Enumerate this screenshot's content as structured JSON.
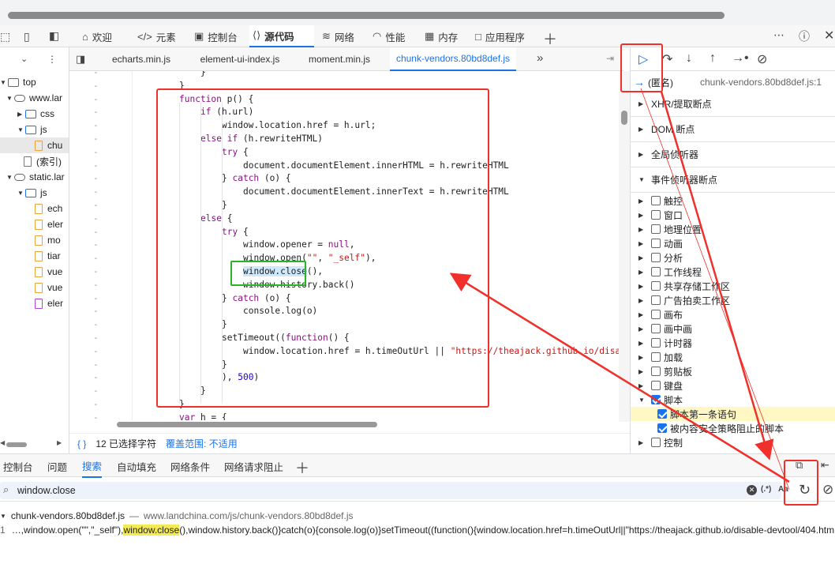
{
  "main_tabs": [
    {
      "label": "欢迎",
      "icon": "home-icon"
    },
    {
      "label": "元素",
      "icon": "code-brackets-icon"
    },
    {
      "label": "控制台",
      "icon": "console-icon"
    },
    {
      "label": "源代码",
      "icon": "sources-icon"
    },
    {
      "label": "网络",
      "icon": "wifi-icon"
    },
    {
      "label": "性能",
      "icon": "gauge-icon"
    },
    {
      "label": "内存",
      "icon": "chip-icon"
    },
    {
      "label": "应用程序",
      "icon": "app-icon"
    }
  ],
  "file_tree": [
    {
      "label": "top",
      "type": "frame"
    },
    {
      "label": "www.lar",
      "type": "cloud"
    },
    {
      "label": "css",
      "type": "folder"
    },
    {
      "label": "js",
      "type": "folder"
    },
    {
      "label": "chu",
      "type": "file"
    },
    {
      "label": "(索引)",
      "type": "file"
    },
    {
      "label": "static.lar",
      "type": "cloud"
    },
    {
      "label": "js",
      "type": "folder"
    },
    {
      "label": "ech",
      "type": "file"
    },
    {
      "label": "eler",
      "type": "file"
    },
    {
      "label": "mo",
      "type": "file"
    },
    {
      "label": "tiar",
      "type": "file"
    },
    {
      "label": "vue",
      "type": "file"
    },
    {
      "label": "vue",
      "type": "file"
    },
    {
      "label": "eler",
      "type": "file"
    }
  ],
  "editor_tabs": [
    "echarts.min.js",
    "element-ui-index.js",
    "moment.min.js",
    "chunk-vendors.80bd8def.js"
  ],
  "code_lines": [
    {
      "indent": 2,
      "text": "}"
    },
    {
      "indent": 1,
      "text": "}"
    },
    {
      "indent": 1,
      "text": "function p() {"
    },
    {
      "indent": 2,
      "text": "if (h.url)"
    },
    {
      "indent": 3,
      "text": "window.location.href = h.url;"
    },
    {
      "indent": 2,
      "text": "else if (h.rewriteHTML)"
    },
    {
      "indent": 3,
      "text": "try {"
    },
    {
      "indent": 4,
      "text": "document.documentElement.innerHTML = h.rewriteHTML"
    },
    {
      "indent": 3,
      "text": "} catch (o) {"
    },
    {
      "indent": 4,
      "text": "document.documentElement.innerText = h.rewriteHTML"
    },
    {
      "indent": 3,
      "text": "}"
    },
    {
      "indent": 2,
      "text": "else {"
    },
    {
      "indent": 3,
      "text": "try {"
    },
    {
      "indent": 4,
      "text": "window.opener = null,"
    },
    {
      "indent": 4,
      "text": "window.open(\"\", \"_self\"),"
    },
    {
      "indent": 4,
      "text": "window.close(),"
    },
    {
      "indent": 4,
      "text": "window.history.back()"
    },
    {
      "indent": 3,
      "text": "} catch (o) {"
    },
    {
      "indent": 4,
      "text": "console.log(o)"
    },
    {
      "indent": 3,
      "text": "}"
    },
    {
      "indent": 3,
      "text": "setTimeout((function() {"
    },
    {
      "indent": 4,
      "text": "window.location.href = h.timeOutUrl || \"https://theajack.github.io/disab"
    },
    {
      "indent": 3,
      "text": "}"
    },
    {
      "indent": 3,
      "text": "), 500)"
    },
    {
      "indent": 2,
      "text": "}"
    },
    {
      "indent": 1,
      "text": "}"
    },
    {
      "indent": 1,
      "text": "var h = {"
    }
  ],
  "gutter_mark": "-",
  "status": {
    "braces": "{ }",
    "selection": "12 已选择字符",
    "coverage": "覆盖范围: 不适用"
  },
  "debugger": {
    "callstack_frame": "(匿名)",
    "callstack_location": "chunk-vendors.80bd8def.js:1",
    "sections": [
      "XHR/提取断点",
      "DOM 断点",
      "全局侦听器",
      "事件侦听器断点"
    ],
    "event_categories": [
      {
        "label": "触控",
        "checked": false
      },
      {
        "label": "窗口",
        "checked": false
      },
      {
        "label": "地理位置",
        "checked": false
      },
      {
        "label": "动画",
        "checked": false
      },
      {
        "label": "分析",
        "checked": false
      },
      {
        "label": "工作线程",
        "checked": false
      },
      {
        "label": "共享存储工作区",
        "checked": false
      },
      {
        "label": "广告拍卖工作区",
        "checked": false
      },
      {
        "label": "画布",
        "checked": false
      },
      {
        "label": "画中画",
        "checked": false
      },
      {
        "label": "计时器",
        "checked": false
      },
      {
        "label": "加载",
        "checked": false
      },
      {
        "label": "剪贴板",
        "checked": false
      },
      {
        "label": "键盘",
        "checked": false
      },
      {
        "label": "脚本",
        "checked": true
      }
    ],
    "script_children": [
      {
        "label": "脚本第一条语句",
        "checked": true
      },
      {
        "label": "被内容安全策略阻止的脚本",
        "checked": true
      }
    ],
    "last_category": {
      "label": "控制",
      "checked": false
    }
  },
  "drawer_tabs": [
    "控制台",
    "问题",
    "搜索",
    "自动填充",
    "网络条件",
    "网络请求阻止"
  ],
  "search": {
    "query": "window.close",
    "regex_label": "(.*)",
    "case_label": "Aa"
  },
  "result": {
    "file": "chunk-vendors.80bd8def.js",
    "separator": "—",
    "url": "www.landchina.com/js/chunk-vendors.80bd8def.js",
    "line_number": "1",
    "before": "…,window.open(\"\",\"_self\"),",
    "match": "window.close",
    "after": "(),window.history.back()}catch(o){console.log(o)}setTimeout((function(){window.location.href=h.timeOutUrl||\"https://theajack.github.io/disable-devtool/404.htm"
  },
  "colors": {
    "accent": "#1a73e8",
    "annotation_red": "#f0302a",
    "annotation_green": "#27b427",
    "match_highlight": "#f4ea54"
  }
}
